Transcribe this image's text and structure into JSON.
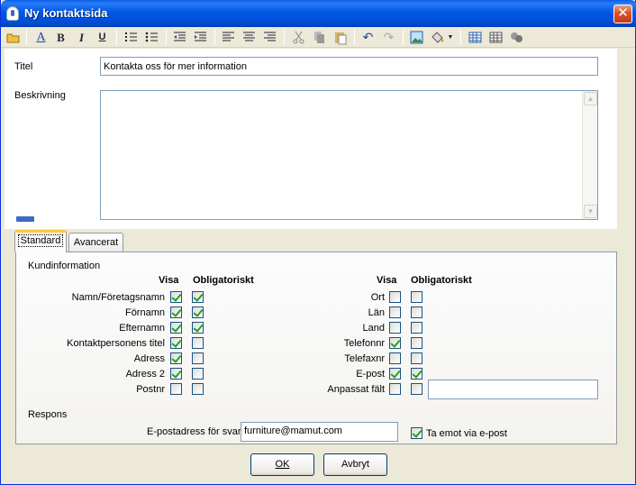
{
  "window": {
    "title": "Ny kontaktsida",
    "close": "✕"
  },
  "toolbar": {
    "icons": [
      "open-folder-icon",
      "font-color-icon",
      "bold-icon",
      "italic-icon",
      "underline-icon",
      "numbered-list-icon",
      "bullet-list-icon",
      "outdent-icon",
      "indent-icon",
      "align-left-icon",
      "align-center-icon",
      "align-right-icon",
      "cut-icon",
      "copy-icon",
      "paste-icon",
      "undo-icon",
      "redo-icon",
      "image-icon",
      "fill-color-icon",
      "table-icon",
      "table-properties-icon",
      "spellcheck-icon"
    ],
    "bold": "B",
    "italic": "I",
    "underline": "U",
    "font_color": "A"
  },
  "form": {
    "titel_label": "Titel",
    "titel_value": "Kontakta oss för mer information",
    "beskrivning_label": "Beskrivning",
    "beskrivning_value": ""
  },
  "tabs": [
    {
      "label": "Standard",
      "active": true
    },
    {
      "label": "Avancerat",
      "active": false
    }
  ],
  "kundinfo": {
    "section": "Kundinformation",
    "col_visa": "Visa",
    "col_oblig": "Obligatoriskt",
    "left": [
      {
        "label": "Namn/Företagsnamn",
        "visa": true,
        "oblig": true
      },
      {
        "label": "Förnamn",
        "visa": true,
        "oblig": true
      },
      {
        "label": "Efternamn",
        "visa": true,
        "oblig": true
      },
      {
        "label": "Kontaktpersonens titel",
        "visa": true,
        "oblig": false
      },
      {
        "label": "Adress",
        "visa": true,
        "oblig": false
      },
      {
        "label": "Adress 2",
        "visa": true,
        "oblig": false
      },
      {
        "label": "Postnr",
        "visa": false,
        "oblig": false
      }
    ],
    "right": [
      {
        "label": "Ort",
        "visa": false,
        "oblig": false
      },
      {
        "label": "Län",
        "visa": false,
        "oblig": false
      },
      {
        "label": "Land",
        "visa": false,
        "oblig": false
      },
      {
        "label": "Telefonnr",
        "visa": true,
        "oblig": false
      },
      {
        "label": "Telefaxnr",
        "visa": false,
        "oblig": false
      },
      {
        "label": "E-post",
        "visa": true,
        "oblig": true
      },
      {
        "label": "Anpassat fält",
        "visa": false,
        "oblig": false
      }
    ],
    "custom_field_value": ""
  },
  "respons": {
    "section": "Respons",
    "email_label": "E-postadress för svar",
    "email_value": "furniture@mamut.com",
    "receive_label": "Ta emot via e-post",
    "receive_checked": true
  },
  "buttons": {
    "ok": "OK",
    "cancel": "Avbryt"
  }
}
